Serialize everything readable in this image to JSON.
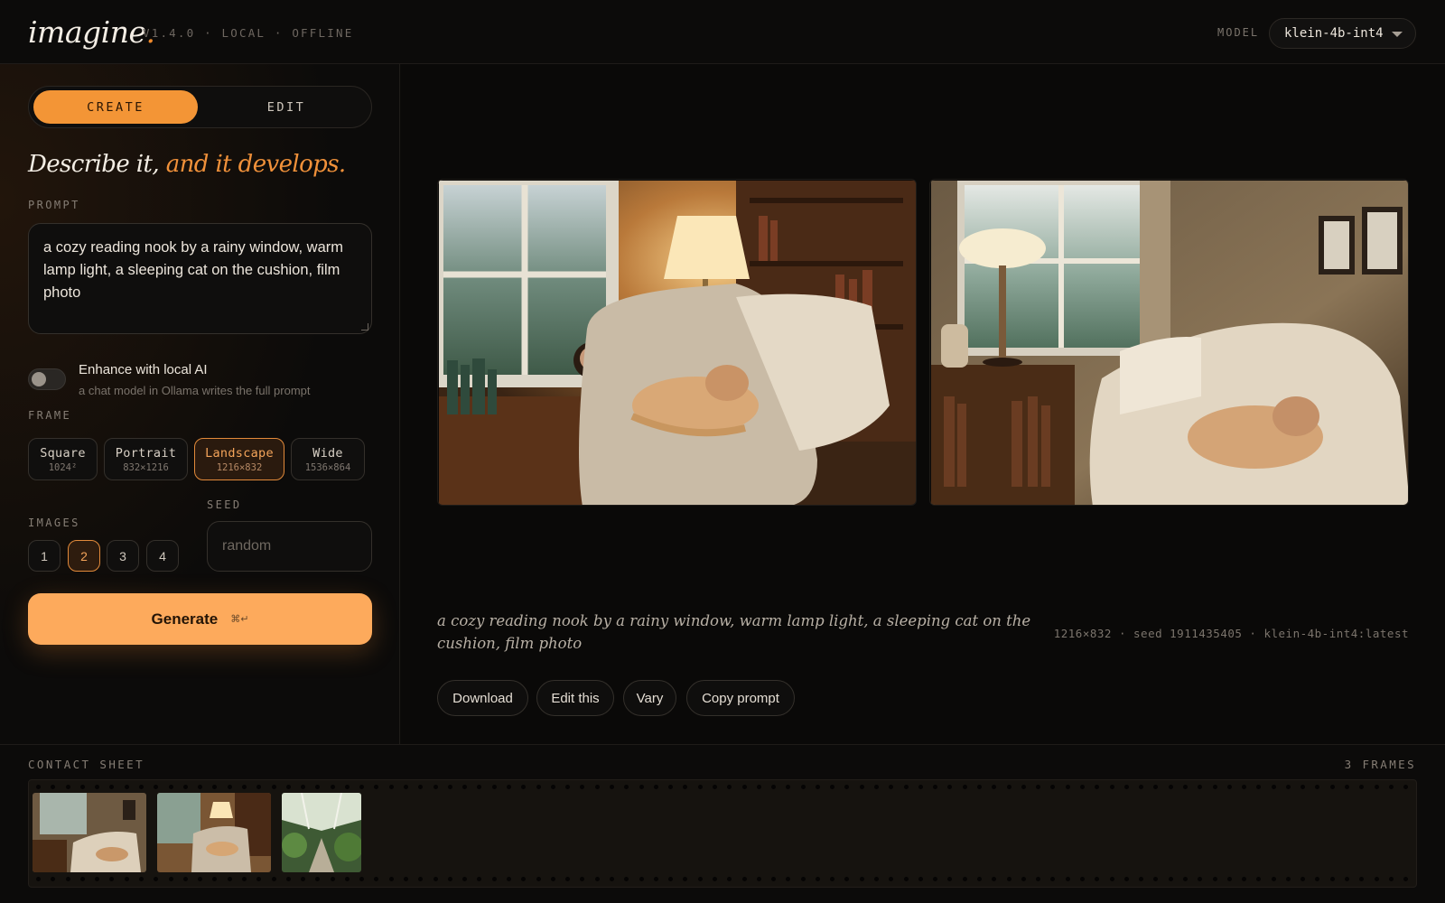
{
  "header": {
    "logo": "imagine",
    "logo_dot": ".",
    "version": "V1.4.0 · LOCAL · OFFLINE",
    "model_label": "MODEL",
    "model_value": "klein-4b-int4"
  },
  "modes": {
    "create": "CREATE",
    "edit": "EDIT",
    "active": "CREATE"
  },
  "headline": {
    "part1": "Describe it,",
    "part2": "and it develops."
  },
  "prompt": {
    "label": "PROMPT",
    "value": "a cozy reading nook by a rainy window, warm lamp light, a sleeping cat on the cushion, film photo"
  },
  "enhance": {
    "title": "Enhance with local AI",
    "subtitle": "a chat model in Ollama writes the full prompt",
    "enabled": false
  },
  "frame": {
    "label": "FRAME",
    "options": [
      {
        "name": "Square",
        "size": "1024²"
      },
      {
        "name": "Portrait",
        "size": "832×1216"
      },
      {
        "name": "Landscape",
        "size": "1216×832"
      },
      {
        "name": "Wide",
        "size": "1536×864"
      }
    ],
    "selected": "Landscape"
  },
  "images": {
    "label": "IMAGES",
    "options": [
      "1",
      "2",
      "3",
      "4"
    ],
    "selected": "2"
  },
  "seed": {
    "label": "SEED",
    "placeholder": "random"
  },
  "generate": {
    "label": "Generate",
    "shortcut": "⌘↵"
  },
  "result": {
    "caption": "a cozy reading nook by a rainy window, warm lamp light, a sleeping cat on the cushion, film photo",
    "meta": "1216×832 · seed 1911435405 · klein-4b-int4:latest",
    "actions": [
      "Download",
      "Edit this",
      "Vary",
      "Copy prompt"
    ]
  },
  "contact_sheet": {
    "label": "CONTACT SHEET",
    "count": "3 FRAMES"
  },
  "colors": {
    "accent": "#f39536",
    "generate": "#fdaa5c",
    "background": "#0b0a09"
  }
}
